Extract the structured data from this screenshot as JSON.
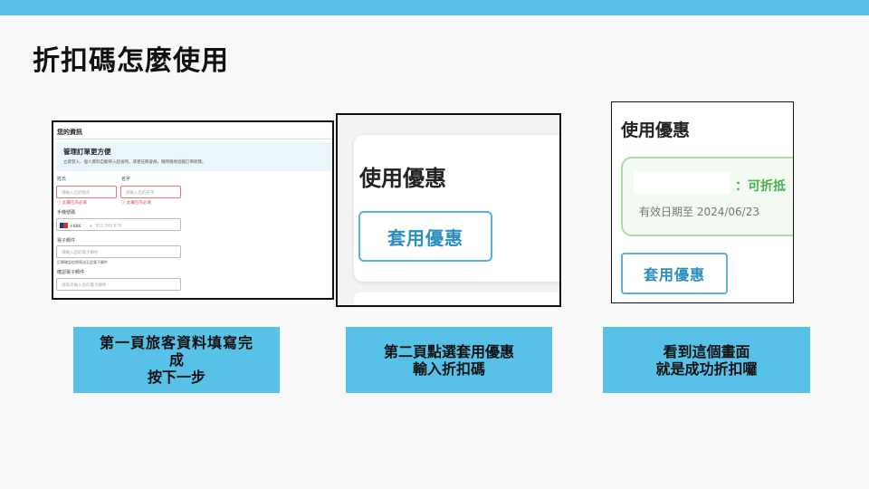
{
  "slide": {
    "title": "折扣碼怎麼使用",
    "accent_color": "#57c1e8"
  },
  "shot1": {
    "section_title": "您的資訊",
    "banner": {
      "title": "管理訂單更方便",
      "text": "立即登入，個人資料自動帶入超省時。或者註冊會員，隨時隨地追蹤訂單狀態。"
    },
    "last_name": {
      "label": "姓氏",
      "placeholder": "請輸入您的姓氏",
      "error": "ⓘ 此欄位為必填"
    },
    "first_name": {
      "label": "名字",
      "placeholder": "請輸入您的名字",
      "error": "ⓘ 此欄位為必填"
    },
    "phone": {
      "label": "手機號碼",
      "country_code": "+886",
      "placeholder": "912 345 678"
    },
    "email": {
      "label": "電子郵件",
      "placeholder": "請輸入您的電子郵件",
      "note": "訂單確認信將寄送至此電子郵件"
    },
    "confirm_email": {
      "label": "確認電子郵件",
      "placeholder": "請再次輸入您的電子郵件"
    }
  },
  "shot2": {
    "heading": "使用優惠",
    "button": "套用優惠"
  },
  "shot3": {
    "heading": "使用優惠",
    "discount_text": "：可折抵",
    "expiry": "有效日期至 2024/06/23",
    "button": "套用優惠"
  },
  "captions": [
    {
      "line1": "第一頁旅客資料填寫完",
      "line2": "成",
      "line3": "按下一步"
    },
    {
      "line1": "第二頁點選套用優惠",
      "line2": "輸入折扣碼"
    },
    {
      "line1": "看到這個畫面",
      "line2": "就是成功折扣囉"
    }
  ]
}
